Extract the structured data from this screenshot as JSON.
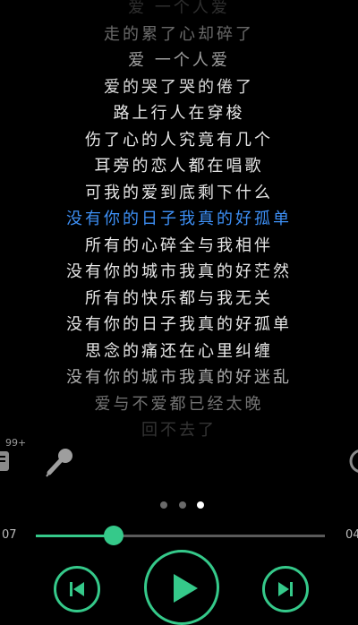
{
  "lyrics": {
    "lines": [
      "爱 一个人爱",
      "走的累了心却碎了",
      "爱 一个人爱",
      "爱的哭了哭的倦了",
      "路上行人在穿梭",
      "伤了心的人究竟有几个",
      "耳旁的恋人都在唱歌",
      "可我的爱到底剩下什么",
      "没有你的日子我真的好孤单",
      "所有的心碎全与我相伴",
      "没有你的城市我真的好茫然",
      "所有的快乐都与我无关",
      "没有你的日子我真的好孤单",
      "思念的痛还在心里纠缠",
      "没有你的城市我真的好迷乱",
      "爱与不爱都已经太晚",
      "回不去了"
    ],
    "current_index": 8,
    "current_color": "#3d8ff5"
  },
  "badge": "99+",
  "page_dots": {
    "count": 3,
    "active": 2
  },
  "player": {
    "elapsed": "07",
    "remaining": "04",
    "progress": 0.27,
    "accent": "#35c98a",
    "icons": {
      "prev": "skip-previous-icon",
      "play": "play-icon",
      "next": "skip-next-icon",
      "mic": "microphone-icon"
    }
  }
}
